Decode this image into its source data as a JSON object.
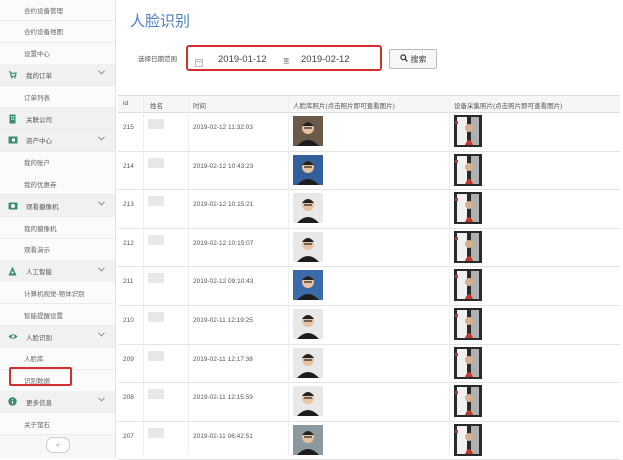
{
  "sidebar": {
    "items": [
      {
        "type": "sub",
        "label": "合约设备管理",
        "icon": ""
      },
      {
        "type": "sub",
        "label": "合约设备地图",
        "icon": ""
      },
      {
        "type": "sub",
        "label": "设置中心",
        "icon": ""
      },
      {
        "type": "group",
        "label": "我的订单",
        "icon": "cart-icon"
      },
      {
        "type": "sub",
        "label": "订单列表",
        "icon": ""
      },
      {
        "type": "group",
        "label": "关联公司",
        "icon": "building-icon"
      },
      {
        "type": "group",
        "label": "资产中心",
        "icon": "wallet-icon"
      },
      {
        "type": "sub",
        "label": "我的账户",
        "icon": ""
      },
      {
        "type": "sub",
        "label": "我的优惠券",
        "icon": ""
      },
      {
        "type": "group",
        "label": "观看摄像机",
        "icon": "camera-icon"
      },
      {
        "type": "sub",
        "label": "我的摄像机",
        "icon": ""
      },
      {
        "type": "sub",
        "label": "观看演示",
        "icon": ""
      },
      {
        "type": "group",
        "label": "人工智能",
        "icon": "robot-icon"
      },
      {
        "type": "sub",
        "label": "计算机视觉-物体识别",
        "icon": ""
      },
      {
        "type": "sub",
        "label": "智能提醒设置",
        "icon": ""
      },
      {
        "type": "group",
        "label": "人脸识别",
        "icon": "eye-icon"
      },
      {
        "type": "sub",
        "label": "人脸库",
        "icon": ""
      },
      {
        "type": "sub",
        "label": "识别数据",
        "icon": ""
      },
      {
        "type": "group",
        "label": "更多信息",
        "icon": "info-icon"
      },
      {
        "type": "sub",
        "label": "关于萤石",
        "icon": ""
      }
    ],
    "collapse_symbol": "«"
  },
  "page_title": "人脸识别",
  "filter": {
    "label": "选择日期范围",
    "start_date": "2019-01-12",
    "separator": "至",
    "end_date": "2019-02-12",
    "search_label": "搜索"
  },
  "table": {
    "headers": [
      "id",
      "姓名",
      "时间",
      "人脸库照片(点击照片即可查看图片)",
      "设备采集照片(点击照片即可查看图片)"
    ],
    "rows": [
      {
        "id": "215",
        "time": "2019-02-12 11:32:03"
      },
      {
        "id": "214",
        "time": "2019-02-12 10:43:23"
      },
      {
        "id": "213",
        "time": "2019-02-12 10:15:21"
      },
      {
        "id": "212",
        "time": "2019-02-12 10:15:07"
      },
      {
        "id": "211",
        "time": "2019-02-12 09:10:43"
      },
      {
        "id": "210",
        "time": "2019-02-11 12:19:25"
      },
      {
        "id": "209",
        "time": "2019-02-11 12:17:38"
      },
      {
        "id": "208",
        "time": "2019-02-11 12:15:59"
      },
      {
        "id": "207",
        "time": "2019-02-11 06:42:51"
      }
    ]
  },
  "colors": {
    "title": "#4a7fc0",
    "highlight": "#d32f2f",
    "sidebar_icon": "#3a8f6a"
  }
}
